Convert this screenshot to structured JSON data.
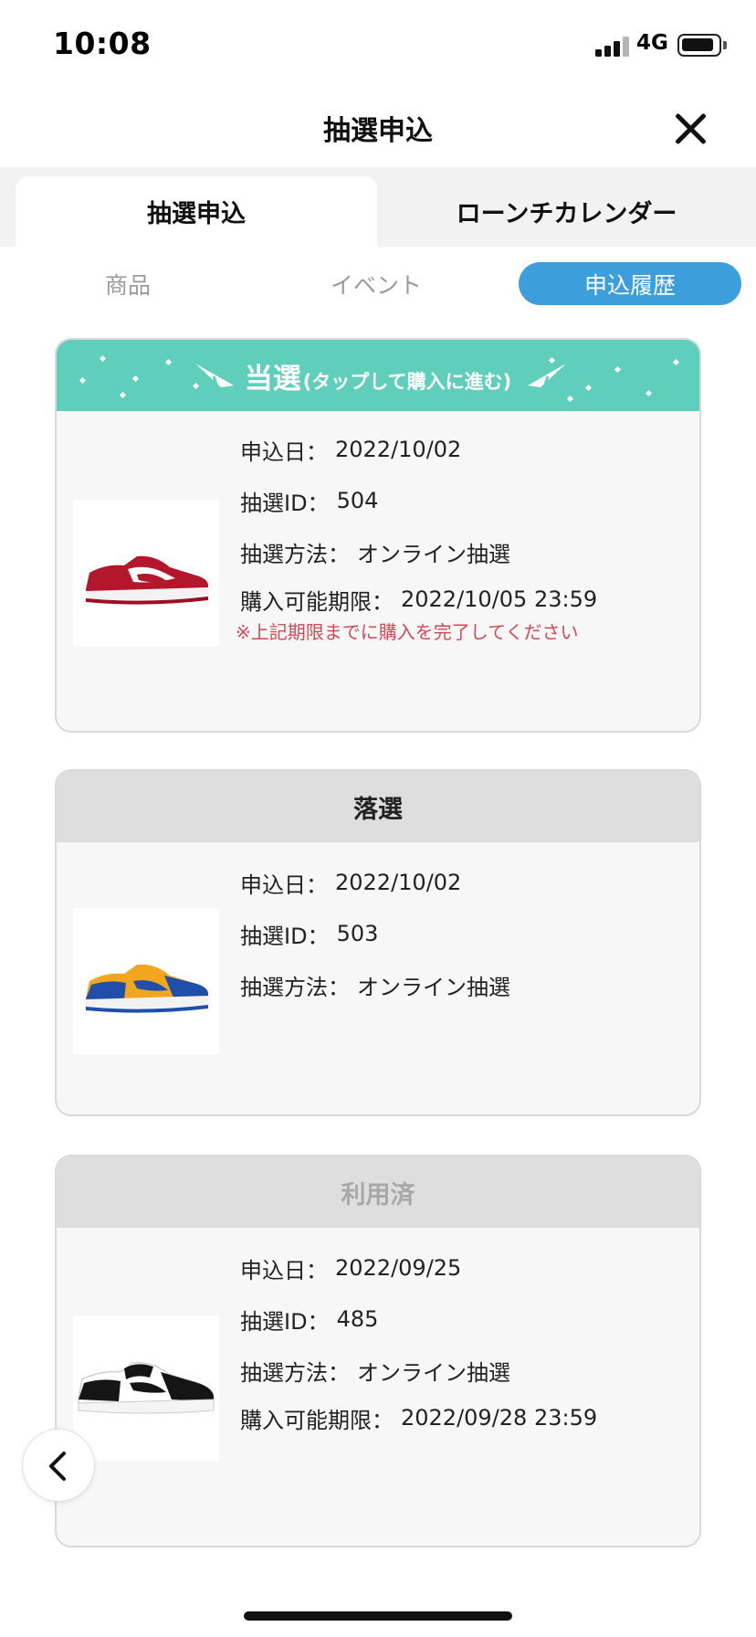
{
  "status_bar": {
    "time": "10:08",
    "network": "4G"
  },
  "header": {
    "title": "抽選申込"
  },
  "main_tabs": [
    {
      "label": "抽選申込",
      "active": true
    },
    {
      "label": "ローンチカレンダー",
      "active": false
    }
  ],
  "sub_tabs": [
    {
      "label": "商品",
      "active": false
    },
    {
      "label": "イベント",
      "active": false
    },
    {
      "label": "申込履歴",
      "active": true
    }
  ],
  "colors": {
    "win_header": "#5fcfbb",
    "active_pill": "#3d9edc",
    "notice_text": "#d24a55",
    "card_bg": "#f7f7f7"
  },
  "entries": [
    {
      "status_main": "当選",
      "status_sub": "(タップして購入に進む)",
      "product_icon": "red-white-sneaker",
      "apply_date_label": "申込日：",
      "apply_date": "2022/10/02",
      "lottery_id_label": "抽選ID：",
      "lottery_id": "504",
      "method_label": "抽選方法：",
      "method": "オンライン抽選",
      "deadline_label": "購入可能期限：",
      "deadline": "2022/10/05 23:59",
      "notice": "※上記期限までに購入を完了してください"
    },
    {
      "status_main": "落選",
      "product_icon": "blue-yellow-sneaker",
      "apply_date_label": "申込日：",
      "apply_date": "2022/10/02",
      "lottery_id_label": "抽選ID：",
      "lottery_id": "503",
      "method_label": "抽選方法：",
      "method": "オンライン抽選"
    },
    {
      "status_main": "利用済",
      "product_icon": "black-white-sneaker",
      "apply_date_label": "申込日：",
      "apply_date": "2022/09/25",
      "lottery_id_label": "抽選ID：",
      "lottery_id": "485",
      "method_label": "抽選方法：",
      "method": "オンライン抽選",
      "deadline_label": "購入可能期限：",
      "deadline": "2022/09/28 23:59"
    }
  ],
  "icons": {
    "close": "close-icon",
    "back": "chevron-left-icon"
  }
}
